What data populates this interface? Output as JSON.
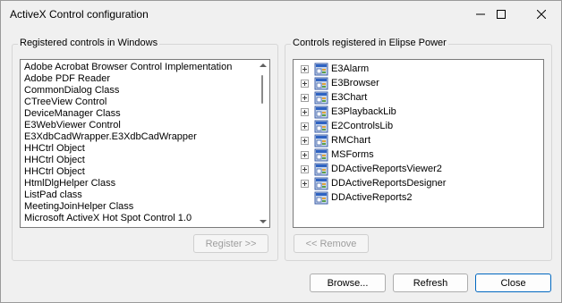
{
  "window": {
    "title": "ActiveX Control configuration"
  },
  "left_group": {
    "label": "Registered controls in Windows",
    "items": [
      "Adobe Acrobat Browser Control Implementation",
      "Adobe PDF Reader",
      "CommonDialog Class",
      "CTreeView Control",
      "DeviceManager Class",
      "E3WebViewer Control",
      "E3XdbCadWrapper.E3XdbCadWrapper",
      "HHCtrl Object",
      "HHCtrl Object",
      "HHCtrl Object",
      "HtmlDlgHelper Class",
      "ListPad class",
      "MeetingJoinHelper Class",
      "Microsoft ActiveX Hot Spot Control 1.0"
    ],
    "register_button": "Register >>"
  },
  "right_group": {
    "label": "Controls registered in Elipse Power",
    "items": [
      {
        "label": "E3Alarm",
        "expandable": true
      },
      {
        "label": "E3Browser",
        "expandable": true
      },
      {
        "label": "E3Chart",
        "expandable": true
      },
      {
        "label": "E3PlaybackLib",
        "expandable": true
      },
      {
        "label": "E2ControlsLib",
        "expandable": true
      },
      {
        "label": "RMChart",
        "expandable": true
      },
      {
        "label": "MSForms",
        "expandable": true
      },
      {
        "label": "DDActiveReportsViewer2",
        "expandable": true
      },
      {
        "label": "DDActiveReportsDesigner",
        "expandable": true
      },
      {
        "label": "DDActiveReports2",
        "expandable": false
      }
    ],
    "remove_button": "<< Remove"
  },
  "footer": {
    "browse_button": "Browse...",
    "refresh_button": "Refresh",
    "close_button": "Close"
  },
  "colors": {
    "accent": "#0067c0",
    "disabled_text": "#9d9d9d"
  }
}
